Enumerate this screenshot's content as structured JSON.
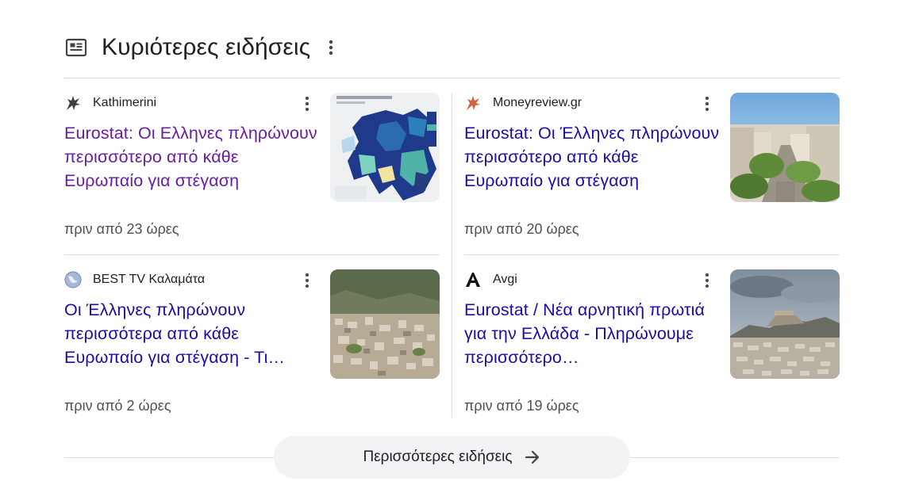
{
  "header": {
    "title": "Κυριότερες ειδήσεις",
    "icon": "newspaper-icon",
    "more_icon": "more-vert-icon"
  },
  "articles": [
    {
      "source": "Kathimerini",
      "source_icon": "kathimerini-logo-icon",
      "headline": "Eurostat: Οι Ελληνες πληρώνουν περισσότερο από κάθε Ευρωπαίο για στέγαση",
      "time": "πριν από 23 ώρες",
      "visited": true,
      "thumbnail": "europe-map-thumbnail"
    },
    {
      "source": "Moneyreview.gr",
      "source_icon": "moneyreview-logo-icon",
      "headline": "Eurostat: Οι Έλληνες πληρώνουν περισσότερο από κάθε Ευρωπαίο για στέγαση",
      "time": "πριν από 20 ώρες",
      "visited": false,
      "thumbnail": "city-street-thumbnail"
    },
    {
      "source": "BEST TV Καλαμάτα",
      "source_icon": "globe-icon",
      "headline": "Οι Έλληνες πληρώνουν περισσότερα από κάθε Ευρωπαίο για στέγαση - Τι…",
      "time": "πριν από 2 ώρες",
      "visited": false,
      "thumbnail": "aerial-city-thumbnail"
    },
    {
      "source": "Avgi",
      "source_icon": "avgi-logo-icon",
      "headline": "Eurostat / Νέα αρνητική πρωτιά για την Ελλάδα - Πληρώνουμε περισσότερο…",
      "time": "πριν από 19 ώρες",
      "visited": false,
      "thumbnail": "athens-panorama-thumbnail"
    }
  ],
  "more_button": {
    "label": "Περισσότερες ειδήσεις",
    "icon": "arrow-right-icon"
  },
  "colors": {
    "link": "#1a0dab",
    "visited_link": "#681da8",
    "text": "#202124",
    "secondary_text": "#4d5156",
    "divider": "#dadce0",
    "button_bg": "#f1f3f4"
  }
}
